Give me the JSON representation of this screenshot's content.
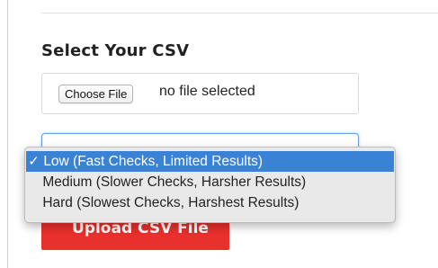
{
  "form": {
    "title": "Select Your CSV",
    "file_input": {
      "button_label": "Choose File",
      "status": "no file selected"
    },
    "select": {
      "selected_index": 0,
      "options": [
        {
          "label": "Low (Fast Checks, Limited Results)",
          "check": "✓"
        },
        {
          "label": "Medium (Slower Checks, Harsher Results)",
          "check": ""
        },
        {
          "label": "Hard (Slowest Checks, Harshest Results)",
          "check": ""
        }
      ]
    },
    "upload_button": {
      "label": "Upload CSV File"
    }
  },
  "colors": {
    "upload_button_bg": "#e8302c",
    "selected_option_bg": "#3a82d6",
    "dropdown_bg": "#e9e9e9"
  }
}
